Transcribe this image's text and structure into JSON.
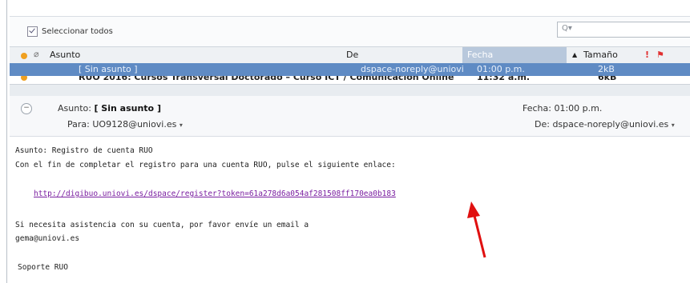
{
  "toolbar": {
    "select_all_label": "Seleccionar todos",
    "search_placeholder": "Q▾"
  },
  "columns": {
    "subject": "Asunto",
    "from": "De",
    "date": "Fecha",
    "size": "Tamaño"
  },
  "selected_row": {
    "subject": "[ Sin asunto ]",
    "from": "dspace-noreply@uniovi",
    "date": "01:00 p.m.",
    "size": "2kB"
  },
  "partial_row": {
    "subject": "RUO 2016: Cursos Transversal Doctorado – Curso ICT / Comunicación Online",
    "from": "",
    "date": "11:32 a.m.",
    "size": "6kB"
  },
  "message": {
    "subject_label": "Asunto:",
    "subject": "[ Sin asunto ]",
    "to_label": "Para:",
    "to": "UO9128@uniovi.es",
    "date_label": "Fecha:",
    "date": "01:00 p.m.",
    "from_label": "De:",
    "from": "dspace-noreply@uniovi.es"
  },
  "body": {
    "line1": "Asunto: Registro de cuenta RUO",
    "line2": "Con el fin de completar el registro para una cuenta RUO, pulse el siguiente enlace:",
    "link": "http://digibuo.uniovi.es/dspace/register?token=61a278d6a054af281508ff170ea0b183",
    "line3": "Si necesita asistencia con su cuenta, por favor envíe un email a",
    "line4": "gema@uniovi.es",
    "signature": "Soporte RUO"
  },
  "colors": {
    "selection": "#5f8bc4",
    "link": "#7a1fa0",
    "arrow": "#e01010",
    "priority": "#e03030"
  },
  "icons": [
    "select-all-icon",
    "search-icon",
    "clear-search-icon",
    "unread-dot-icon",
    "attachment-icon",
    "priority-icon",
    "flag-icon",
    "collapse-icon",
    "sort-asc-icon",
    "red-arrow-annotation"
  ]
}
